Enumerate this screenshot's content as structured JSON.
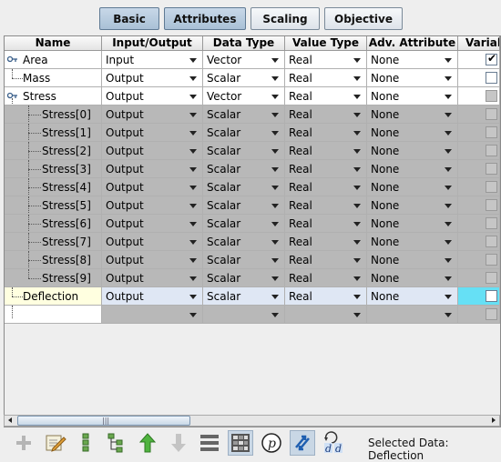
{
  "tabs": [
    {
      "label": "Basic",
      "active": true
    },
    {
      "label": "Attributes",
      "active": true
    },
    {
      "label": "Scaling",
      "active": false
    },
    {
      "label": "Objective",
      "active": false
    }
  ],
  "columns": [
    "Name",
    "Input/Output",
    "Data Type",
    "Value Type",
    "Adv. Attribute",
    "Variab"
  ],
  "rows": [
    {
      "name": "Area",
      "io": "Input",
      "dtype": "Vector",
      "vtype": "Real",
      "adv": "None",
      "checked": true,
      "style": "white",
      "indent": 0,
      "key": true
    },
    {
      "name": "Mass",
      "io": "Output",
      "dtype": "Scalar",
      "vtype": "Real",
      "adv": "None",
      "checked": false,
      "style": "white",
      "indent": 0,
      "key": false
    },
    {
      "name": "Stress",
      "io": "Output",
      "dtype": "Vector",
      "vtype": "Real",
      "adv": "None",
      "checked": false,
      "style": "white",
      "indent": 0,
      "key": true,
      "disabled_cb": true
    },
    {
      "name": "Stress[0]",
      "io": "Output",
      "dtype": "Scalar",
      "vtype": "Real",
      "adv": "None",
      "checked": false,
      "style": "gray",
      "indent": 1
    },
    {
      "name": "Stress[1]",
      "io": "Output",
      "dtype": "Scalar",
      "vtype": "Real",
      "adv": "None",
      "checked": false,
      "style": "gray",
      "indent": 1
    },
    {
      "name": "Stress[2]",
      "io": "Output",
      "dtype": "Scalar",
      "vtype": "Real",
      "adv": "None",
      "checked": false,
      "style": "gray",
      "indent": 1
    },
    {
      "name": "Stress[3]",
      "io": "Output",
      "dtype": "Scalar",
      "vtype": "Real",
      "adv": "None",
      "checked": false,
      "style": "gray",
      "indent": 1
    },
    {
      "name": "Stress[4]",
      "io": "Output",
      "dtype": "Scalar",
      "vtype": "Real",
      "adv": "None",
      "checked": false,
      "style": "gray",
      "indent": 1
    },
    {
      "name": "Stress[5]",
      "io": "Output",
      "dtype": "Scalar",
      "vtype": "Real",
      "adv": "None",
      "checked": false,
      "style": "gray",
      "indent": 1
    },
    {
      "name": "Stress[6]",
      "io": "Output",
      "dtype": "Scalar",
      "vtype": "Real",
      "adv": "None",
      "checked": false,
      "style": "gray",
      "indent": 1
    },
    {
      "name": "Stress[7]",
      "io": "Output",
      "dtype": "Scalar",
      "vtype": "Real",
      "adv": "None",
      "checked": false,
      "style": "gray",
      "indent": 1
    },
    {
      "name": "Stress[8]",
      "io": "Output",
      "dtype": "Scalar",
      "vtype": "Real",
      "adv": "None",
      "checked": false,
      "style": "gray",
      "indent": 1
    },
    {
      "name": "Stress[9]",
      "io": "Output",
      "dtype": "Scalar",
      "vtype": "Real",
      "adv": "None",
      "checked": false,
      "style": "gray",
      "indent": 1
    },
    {
      "name": "Deflection",
      "io": "Output",
      "dtype": "Scalar",
      "vtype": "Real",
      "adv": "None",
      "checked": false,
      "style": "sel",
      "indent": 0
    },
    {
      "name": "",
      "io": "",
      "dtype": "",
      "vtype": "",
      "adv": "",
      "checked": false,
      "style": "empty",
      "indent": 0,
      "disabled_cb": true
    }
  ],
  "toolbar": [
    "add-icon",
    "edit-icon",
    "vertical-chain-icon",
    "tree-structure-icon",
    "move-up-icon",
    "move-down-icon",
    "list-view-icon",
    "grid-view-icon",
    "parameter-p-icon",
    "link-arrows-icon",
    "derivative-dd-icon"
  ],
  "status": "Selected Data: Deflection",
  "colors": {
    "accent": "#66e0f5",
    "selected_name": "#ffffe0",
    "gray_row": "#b8b8b8"
  }
}
